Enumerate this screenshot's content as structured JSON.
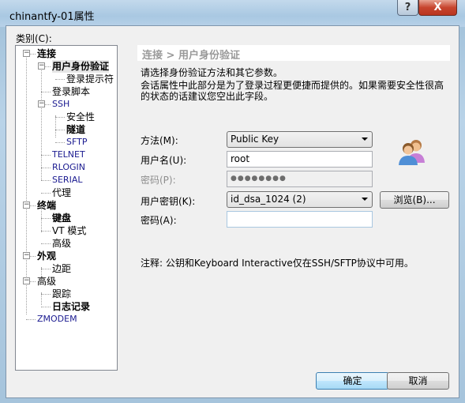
{
  "window": {
    "title": "chinantfy-01属性",
    "help_label": "?",
    "close_label": "X"
  },
  "category_label": "类别(C):",
  "tree": [
    {
      "label": "连接",
      "level": 0,
      "bold": true,
      "expander": "−"
    },
    {
      "label": "用户身份验证",
      "level": 1,
      "bold": true,
      "expander": "−",
      "selected": true
    },
    {
      "label": "登录提示符",
      "level": 2
    },
    {
      "label": "登录脚本",
      "level": 1
    },
    {
      "label": "SSH",
      "level": 1,
      "expander": "−",
      "en": true
    },
    {
      "label": "安全性",
      "level": 2
    },
    {
      "label": "隧道",
      "level": 2,
      "bold": true
    },
    {
      "label": "SFTP",
      "level": 2,
      "en": true
    },
    {
      "label": "TELNET",
      "level": 1,
      "en": true
    },
    {
      "label": "RLOGIN",
      "level": 1,
      "en": true
    },
    {
      "label": "SERIAL",
      "level": 1,
      "en": true
    },
    {
      "label": "代理",
      "level": 1
    },
    {
      "label": "终端",
      "level": 0,
      "bold": true,
      "expander": "−"
    },
    {
      "label": "键盘",
      "level": 1,
      "bold": true
    },
    {
      "label": "VT 模式",
      "level": 1
    },
    {
      "label": "高级",
      "level": 1
    },
    {
      "label": "外观",
      "level": 0,
      "bold": true,
      "expander": "−"
    },
    {
      "label": "边距",
      "level": 1
    },
    {
      "label": "高级",
      "level": 0,
      "expander": "−"
    },
    {
      "label": "跟踪",
      "level": 1
    },
    {
      "label": "日志记录",
      "level": 1,
      "bold": true
    },
    {
      "label": "ZMODEM",
      "level": 0,
      "en": true
    }
  ],
  "panel": {
    "breadcrumb": "连接 > 用户身份验证",
    "intro": "请选择身份验证方法和其它参数。",
    "description_line1": "会话属性中此部分是为了登录过程更便捷而提供的。如果需要安全性很高",
    "description_line2": "的状态的话建议您空出此字段。",
    "method_label": "方法(M):",
    "method_value": "Public Key",
    "username_label": "用户名(U):",
    "username_value": "root",
    "password_label": "密码(P):",
    "password_value": "●●●●●●●●",
    "userkey_label": "用户密钥(K):",
    "userkey_value": "id_dsa_1024 (2)",
    "browse_label": "浏览(B)...",
    "passphrase_label": "密码(A):",
    "passphrase_value": "",
    "note": "注释: 公钥和Keyboard Interactive仅在SSH/SFTP协议中可用。",
    "icon": "users-icon"
  },
  "buttons": {
    "ok": "确定",
    "cancel": "取消"
  }
}
